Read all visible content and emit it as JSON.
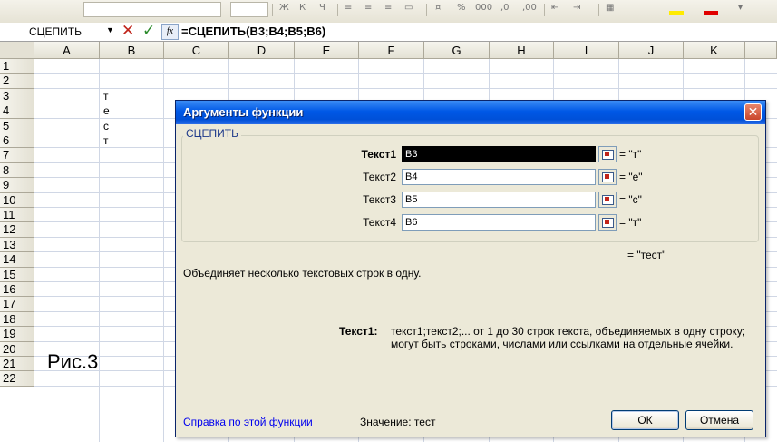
{
  "formula_bar": {
    "name_box": "СЦЕПИТЬ",
    "fx_label": "fx",
    "formula": "=СЦЕПИТЬ(B3;B4;B5;B6)"
  },
  "grid": {
    "columns": [
      "A",
      "B",
      "C",
      "D",
      "E",
      "F",
      "G",
      "H",
      "I",
      "J",
      "K"
    ],
    "rows": [
      "1",
      "2",
      "3",
      "4",
      "5",
      "6",
      "7",
      "8",
      "9",
      "10",
      "11",
      "12",
      "13",
      "14",
      "15",
      "16",
      "17",
      "18",
      "19",
      "20",
      "21",
      "22"
    ],
    "cells": {
      "B3": "т",
      "B4": "е",
      "B5": "с",
      "B6": "т"
    }
  },
  "caption": "Рис.3",
  "dialog": {
    "title": "Аргументы функции",
    "close_label": "✕",
    "function_name": "СЦЕПИТЬ",
    "arguments": [
      {
        "label": "Текст1",
        "input": "B3",
        "value": "= \"т\"",
        "active": true
      },
      {
        "label": "Текст2",
        "input": "B4",
        "value": "= \"е\"",
        "active": false
      },
      {
        "label": "Текст3",
        "input": "B5",
        "value": "= \"с\"",
        "active": false
      },
      {
        "label": "Текст4",
        "input": "B6",
        "value": "= \"т\"",
        "active": false
      }
    ],
    "result": "= \"тест\"",
    "description": "Объединяет несколько текстовых строк в одну.",
    "help_label": "Текст1:",
    "help_text": "текст1;текст2;... от 1 до 30 строк текста, объединяемых в одну строку; могут быть строками, числами или ссылками на отдельные ячейки.",
    "help_link": "Справка по этой функции",
    "value_label": "Значение:",
    "value_text": "тест",
    "ok_label": "ОК",
    "cancel_label": "Отмена"
  },
  "colors": {
    "titlebar": "#0058e6",
    "dialog_bg": "#ece9d8",
    "link": "#0000ee",
    "cancel_icon": "#c0241a",
    "enter_icon": "#2a8a2a"
  }
}
